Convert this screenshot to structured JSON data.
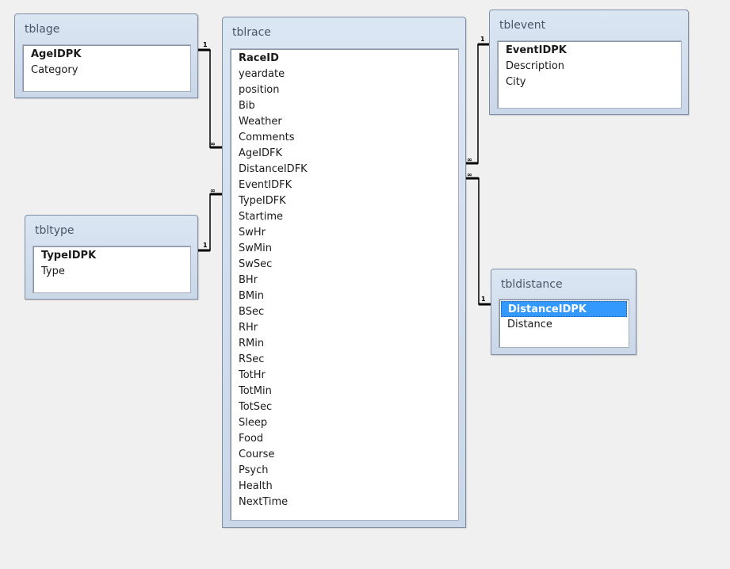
{
  "tables": {
    "tblage": {
      "title": "tblage",
      "fields": [
        {
          "name": "AgeIDPK",
          "pk": true
        },
        {
          "name": "Category",
          "pk": false
        }
      ]
    },
    "tbltype": {
      "title": "tbltype",
      "fields": [
        {
          "name": "TypeIDPK",
          "pk": true
        },
        {
          "name": "Type",
          "pk": false
        }
      ]
    },
    "tblrace": {
      "title": "tblrace",
      "fields": [
        {
          "name": "RaceID",
          "pk": true
        },
        {
          "name": "yeardate",
          "pk": false
        },
        {
          "name": "position",
          "pk": false
        },
        {
          "name": "Bib",
          "pk": false
        },
        {
          "name": "Weather",
          "pk": false
        },
        {
          "name": "Comments",
          "pk": false
        },
        {
          "name": "AgeIDFK",
          "pk": false
        },
        {
          "name": "DistanceIDFK",
          "pk": false
        },
        {
          "name": "EventIDFK",
          "pk": false
        },
        {
          "name": "TypeIDFK",
          "pk": false
        },
        {
          "name": "Startime",
          "pk": false
        },
        {
          "name": "SwHr",
          "pk": false
        },
        {
          "name": "SwMin",
          "pk": false
        },
        {
          "name": "SwSec",
          "pk": false
        },
        {
          "name": "BHr",
          "pk": false
        },
        {
          "name": "BMin",
          "pk": false
        },
        {
          "name": "BSec",
          "pk": false
        },
        {
          "name": "RHr",
          "pk": false
        },
        {
          "name": "RMin",
          "pk": false
        },
        {
          "name": "RSec",
          "pk": false
        },
        {
          "name": "TotHr",
          "pk": false
        },
        {
          "name": "TotMin",
          "pk": false
        },
        {
          "name": "TotSec",
          "pk": false
        },
        {
          "name": "Sleep",
          "pk": false
        },
        {
          "name": "Food",
          "pk": false
        },
        {
          "name": "Course",
          "pk": false
        },
        {
          "name": "Psych",
          "pk": false
        },
        {
          "name": "Health",
          "pk": false
        },
        {
          "name": "NextTime",
          "pk": false
        }
      ]
    },
    "tblevent": {
      "title": "tblevent",
      "fields": [
        {
          "name": "EventIDPK",
          "pk": true
        },
        {
          "name": "Description",
          "pk": false
        },
        {
          "name": "City",
          "pk": false
        }
      ]
    },
    "tbldistance": {
      "title": "tbldistance",
      "fields": [
        {
          "name": "DistanceIDPK",
          "pk": true,
          "selected": true
        },
        {
          "name": "Distance",
          "pk": false
        }
      ]
    }
  },
  "relationships": [
    {
      "from": "tblage.AgeIDPK",
      "to": "tblrace.AgeIDFK",
      "one_label": "1",
      "many_label": "∞"
    },
    {
      "from": "tbltype.TypeIDPK",
      "to": "tblrace.TypeIDFK",
      "one_label": "1",
      "many_label": "∞"
    },
    {
      "from": "tblevent.EventIDPK",
      "to": "tblrace.EventIDFK",
      "one_label": "1",
      "many_label": "∞"
    },
    {
      "from": "tbldistance.DistanceIDPK",
      "to": "tblrace.DistanceIDFK",
      "one_label": "1",
      "many_label": "∞"
    }
  ]
}
